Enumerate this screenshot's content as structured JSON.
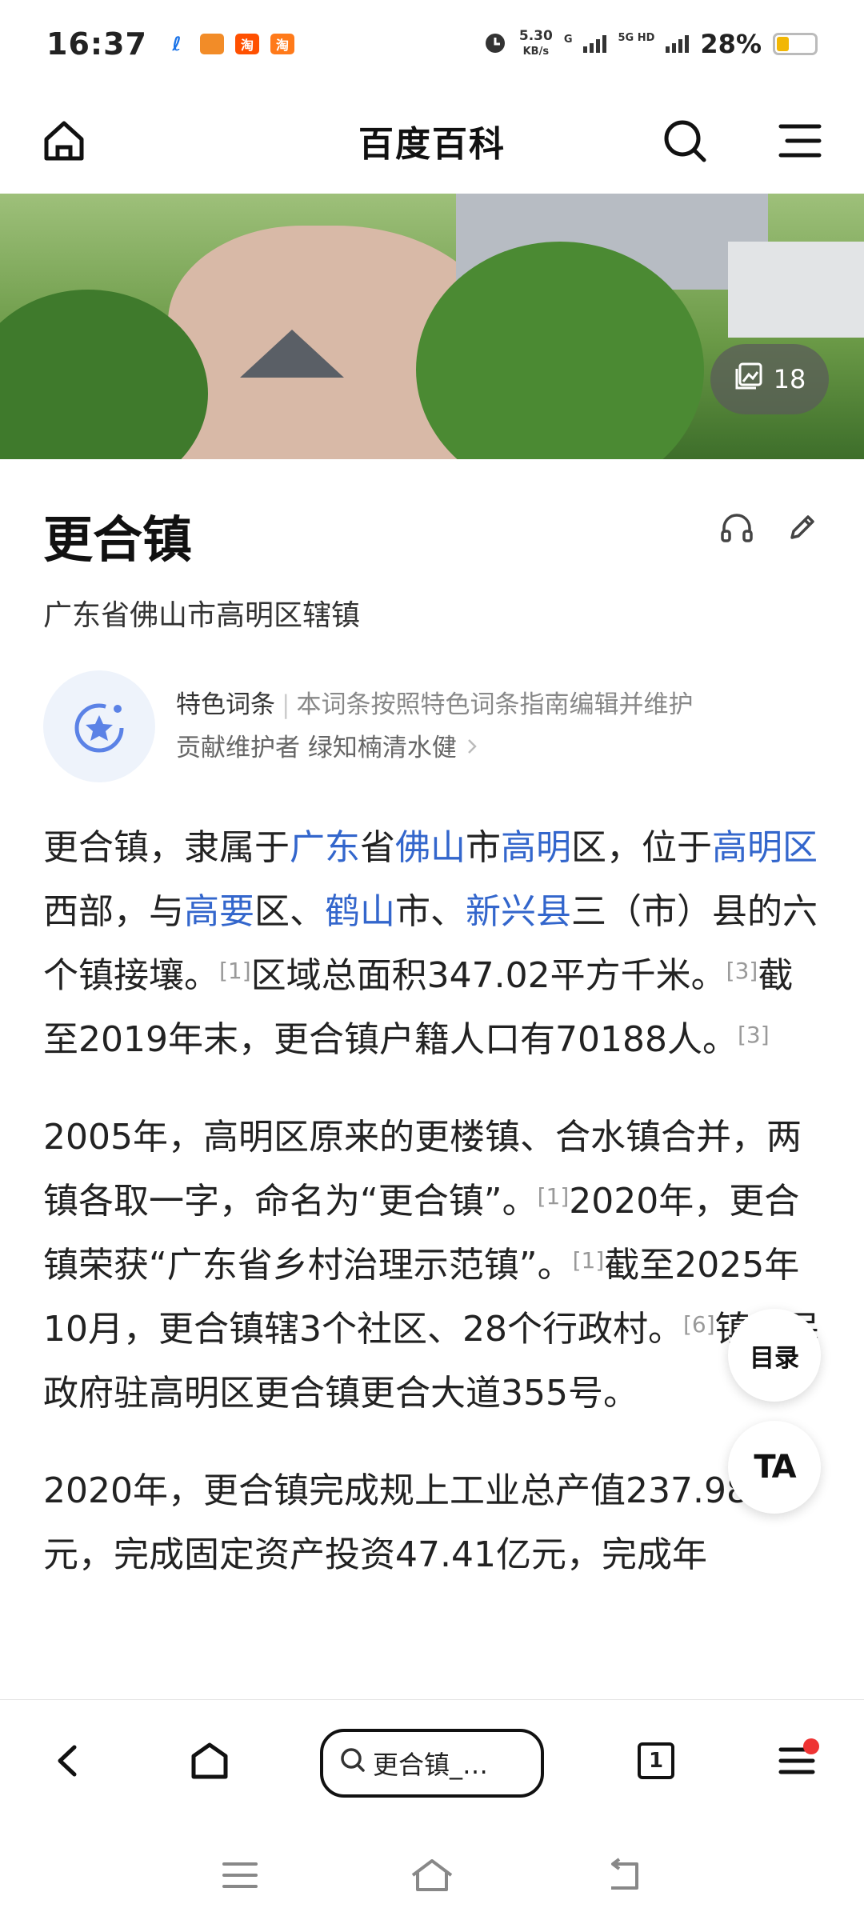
{
  "status_bar": {
    "time": "16:37",
    "speed_value": "5.30",
    "speed_unit": "KB/s",
    "network_g": "G",
    "network_5g": "5G HD",
    "battery_percent": "28%",
    "battery_level": 0.28,
    "app_icons": [
      "telecom-icon",
      "app-icon",
      "taobao-icon",
      "taobao-icon"
    ],
    "app_labels": [
      "",
      "",
      "淘",
      "淘"
    ]
  },
  "header": {
    "title": "百度百科"
  },
  "hero": {
    "gallery_count": "18"
  },
  "entry": {
    "title": "更合镇",
    "subtitle": "广东省佛山市高明区辖镇"
  },
  "featured": {
    "label": "特色词条",
    "separator": "|",
    "description": "本词条按照特色词条指南编辑并维护",
    "contributor_label": "贡献维护者",
    "contributor_name": "绿知楠清水健"
  },
  "article": {
    "p1": {
      "t1": "更合镇，隶属于",
      "l1": "广东",
      "t2": "省",
      "l2": "佛山",
      "t3": "市",
      "l3": "高明",
      "t4": "区，位于",
      "l4": "高明区",
      "t5": "西部，与",
      "l5": "高要",
      "t6": "区、",
      "l6": "鹤山",
      "t7": "市、",
      "l7": "新兴县",
      "t8": "三（市）县的六个镇接壤。",
      "r1": "[1]",
      "t9": "区域总面积347.02平方千米。",
      "r2": "[3]",
      "t10": "截至2019年末，更合镇户籍人口有70188人。",
      "r3": "[3]"
    },
    "p2": {
      "t1": "2005年，高明区原来的更楼镇、合水镇合并，两镇各取一字，命名为“更合镇”。",
      "r1": "[1]",
      "t2": "2020年，更合镇荣获“广东省乡村治理示范镇”。",
      "r2": "[1]",
      "t3": "截至2025年10月，更合镇辖3个社区、28个行政村。",
      "r3": "[6]",
      "t4": "镇人民政府驻高明区更合镇更合大道355号。"
    },
    "p3": {
      "t1": "2020年，更合镇完成规上工业总产值237.98亿元，完成固定资产投资47.41亿元，完成年"
    }
  },
  "float_buttons": {
    "toc": "目录",
    "font": "TA"
  },
  "browser_bar": {
    "search_text": "更合镇_…",
    "tab_count": "1"
  }
}
